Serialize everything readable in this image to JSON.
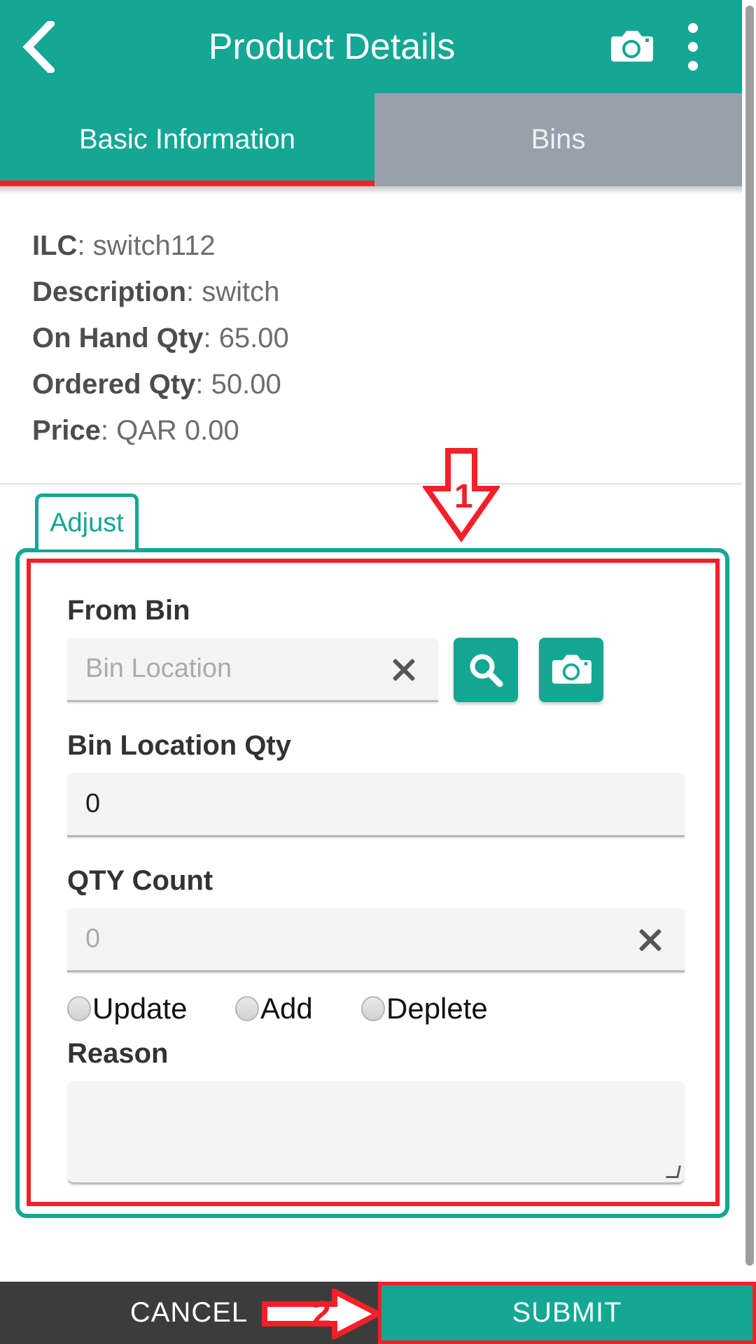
{
  "appbar": {
    "title": "Product Details",
    "back_icon": "back-chevron-icon",
    "camera_icon": "camera-icon",
    "overflow_icon": "kebab-menu-icon"
  },
  "tabs": [
    {
      "label": "Basic Information",
      "active": true
    },
    {
      "label": "Bins",
      "active": false
    }
  ],
  "product": {
    "rows": [
      {
        "label": "ILC",
        "value": "switch112"
      },
      {
        "label": "Description",
        "value": "switch"
      },
      {
        "label": "On Hand Qty",
        "value": "65.00"
      },
      {
        "label": "Ordered Qty",
        "value": "50.00"
      },
      {
        "label": "Price",
        "value": "QAR 0.00"
      }
    ]
  },
  "adjust": {
    "chip_label": "Adjust",
    "from_bin": {
      "label": "From Bin",
      "placeholder": "Bin Location",
      "value": "",
      "clear_icon": "clear-x-icon",
      "search_icon": "search-icon",
      "camera_icon": "camera-icon"
    },
    "bin_location_qty": {
      "label": "Bin Location Qty",
      "value": "0",
      "placeholder": "0"
    },
    "qty_count": {
      "label": "QTY Count",
      "value": "",
      "placeholder": "0",
      "clear_icon": "clear-x-icon"
    },
    "mode_options": [
      {
        "label": "Update",
        "selected": false
      },
      {
        "label": "Add",
        "selected": false
      },
      {
        "label": "Deplete",
        "selected": false
      }
    ],
    "reason": {
      "label": "Reason",
      "value": "",
      "placeholder": ""
    }
  },
  "footer": {
    "cancel_label": "CANCEL",
    "submit_label": "SUBMIT"
  },
  "annotations": [
    {
      "number": "1",
      "direction": "down"
    },
    {
      "number": "2",
      "direction": "right"
    }
  ],
  "colors": {
    "teal": "#13a794",
    "annotation_red": "#f41f27",
    "inactive_tab_gray": "#97a0ab",
    "footer_dark": "#3c3c3c"
  }
}
